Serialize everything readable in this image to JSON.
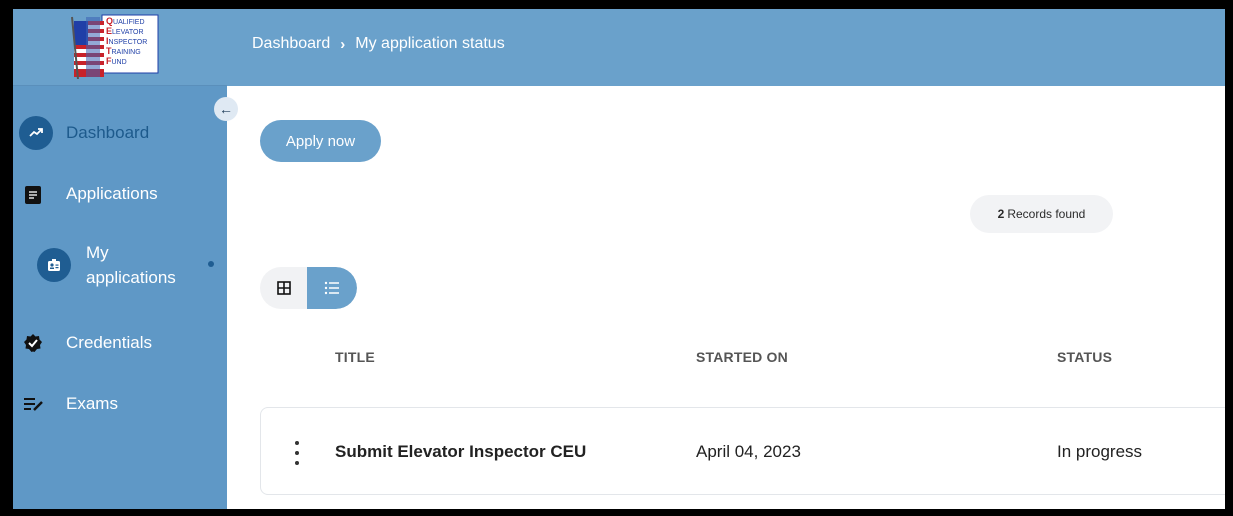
{
  "brand": {
    "logo_text": [
      "QUALIFIED",
      "ELEVATOR",
      "INSPECTOR",
      "TRAINING",
      "FUND"
    ]
  },
  "sidebar": {
    "collapse_icon": "arrow-left-icon",
    "items": [
      {
        "label": "Dashboard",
        "icon": "trending-up-icon",
        "active": true
      },
      {
        "label": "Applications",
        "icon": "document-icon"
      },
      {
        "label_line1": "My",
        "label_line2": "applications",
        "icon": "id-badge-icon"
      },
      {
        "label": "Credentials",
        "icon": "verified-badge-icon"
      },
      {
        "label": "Exams",
        "icon": "edit-list-icon"
      }
    ]
  },
  "header": {
    "breadcrumb": [
      "Dashboard",
      "My application status"
    ],
    "separator": "›"
  },
  "main": {
    "apply_button": "Apply now",
    "records": {
      "count": "2",
      "suffix": "Records found"
    },
    "view_toggle": {
      "selected": "list"
    },
    "table": {
      "columns": [
        "TITLE",
        "STARTED ON",
        "STATUS"
      ],
      "rows": [
        {
          "title": "Submit Elevator Inspector CEU",
          "started_on": "April 04, 2023",
          "status": "In progress"
        }
      ]
    }
  },
  "colors": {
    "sidebar": "#5f98c6",
    "header": "#6aa1cb",
    "accent_dark": "#1f5d92"
  }
}
